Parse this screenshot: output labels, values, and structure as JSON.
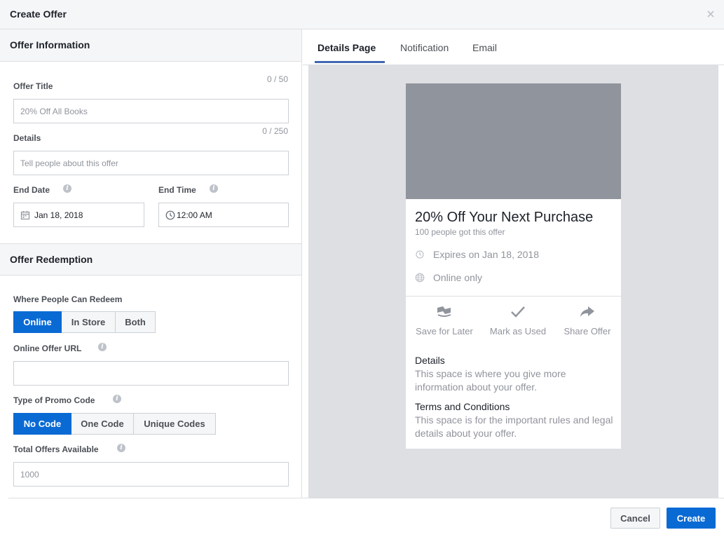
{
  "dialog": {
    "title": "Create Offer"
  },
  "offer_information": {
    "section_title": "Offer Information",
    "offer_title": {
      "label": "Offer Title",
      "counter": "0 / 50",
      "placeholder": "20% Off All Books"
    },
    "details": {
      "label": "Details",
      "counter": "0 / 250",
      "placeholder": "Tell people about this offer"
    },
    "end_date": {
      "label": "End Date",
      "value": "Jan 18, 2018"
    },
    "end_time": {
      "label": "End Time",
      "value": "12:00 AM"
    }
  },
  "offer_redemption": {
    "section_title": "Offer Redemption",
    "where": {
      "label": "Where People Can Redeem",
      "options": [
        "Online",
        "In Store",
        "Both"
      ],
      "selected": "Online"
    },
    "online_url": {
      "label": "Online Offer URL",
      "value": ""
    },
    "promo_code": {
      "label": "Type of Promo Code",
      "options": [
        "No Code",
        "One Code",
        "Unique Codes"
      ],
      "selected": "No Code"
    },
    "total_offers": {
      "label": "Total Offers Available",
      "placeholder": "1000"
    }
  },
  "preview": {
    "tabs": [
      "Details Page",
      "Notification",
      "Email"
    ],
    "active_tab": "Details Page",
    "card": {
      "title": "20% Off Your Next Purchase",
      "subtitle": "100 people got this offer",
      "expires": "Expires on Jan 18, 2018",
      "location": "Online only",
      "actions": [
        "Save for Later",
        "Mark as Used",
        "Share Offer"
      ],
      "details_title": "Details",
      "details_text": "This space is where you give more information about your offer.",
      "terms_title": "Terms and Conditions",
      "terms_text": "This space is for the important rules and legal details about your offer."
    }
  },
  "footer": {
    "cancel_label": "Cancel",
    "create_label": "Create"
  },
  "colors": {
    "accent": "#0a6ad4",
    "tab_underline": "#4267b2",
    "header_bg": "#f5f6f7",
    "preview_bg": "#dddfe2",
    "image_placeholder": "#90949c"
  },
  "icons": {
    "close": "close-icon",
    "info": "info-icon",
    "calendar": "calendar-icon",
    "clock": "clock-icon",
    "globe": "globe-icon",
    "save": "save-offer-icon",
    "check": "checkmark-icon",
    "share": "share-arrow-icon"
  }
}
